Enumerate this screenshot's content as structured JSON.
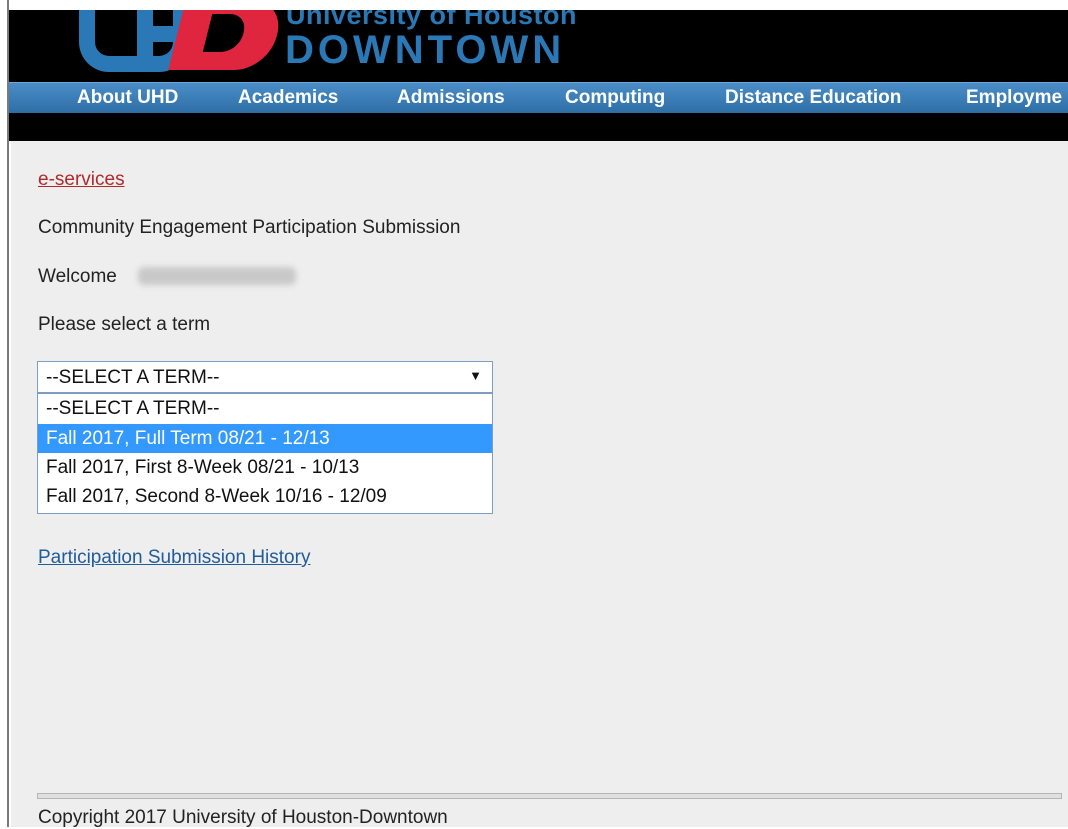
{
  "header": {
    "logo_letters": "UHD",
    "logo_line1": "University of Houston",
    "logo_line2": "DOWNTOWN",
    "colors": {
      "blue": "#2a78b6",
      "red": "#e0263f",
      "nav": "#3b7fbd"
    }
  },
  "nav": {
    "items": [
      "About UHD",
      "Academics",
      "Admissions",
      "Computing",
      "Distance Education",
      "Employme"
    ]
  },
  "main": {
    "eservices_link": "e-services",
    "page_heading": "Community Engagement Participation Submission",
    "welcome_label": "Welcome",
    "prompt": "Please select a term",
    "term_select": {
      "selected": "--SELECT A TERM--",
      "options": [
        "--SELECT A TERM--",
        "Fall 2017, Full Term 08/21 - 12/13",
        "Fall 2017, First 8-Week 08/21 - 10/13",
        "Fall 2017, Second 8-Week 10/16 - 12/09"
      ],
      "highlighted_option": "Fall 2017, Full Term 08/21 - 12/13"
    },
    "history_link": "Participation Submission History"
  },
  "footer": {
    "copyright": "Copyright 2017 University of Houston-Downtown"
  }
}
